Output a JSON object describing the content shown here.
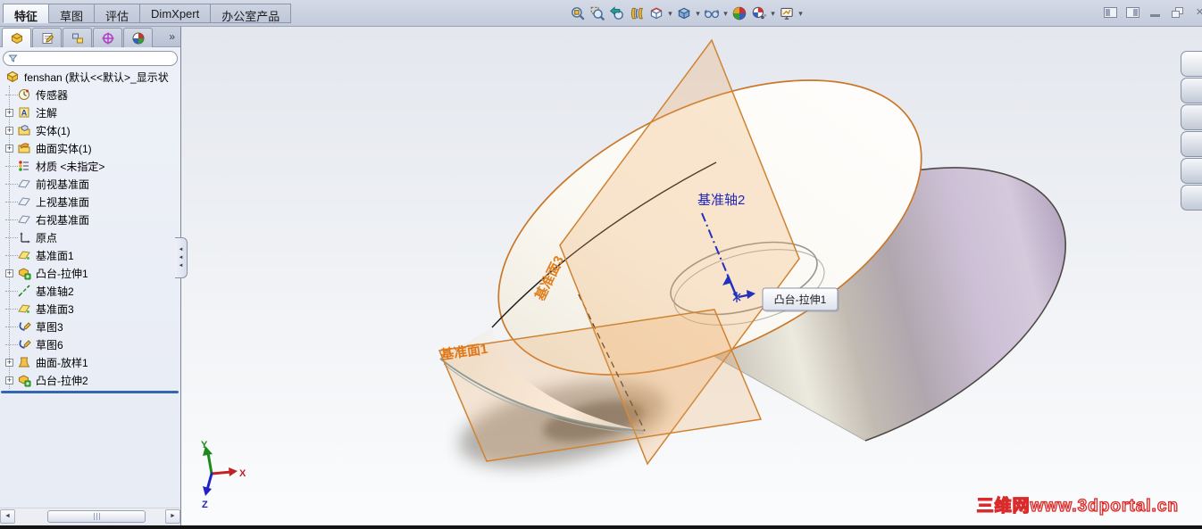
{
  "command_tabs": [
    {
      "label": "特征",
      "active": true
    },
    {
      "label": "草图",
      "active": false
    },
    {
      "label": "评估",
      "active": false
    },
    {
      "label": "DimXpert",
      "active": false
    },
    {
      "label": "办公室产品",
      "active": false
    }
  ],
  "headsup_toolbar": [
    {
      "name": "zoom-to-fit",
      "dropdown": false
    },
    {
      "name": "zoom-to-area",
      "dropdown": false
    },
    {
      "name": "previous-view",
      "dropdown": false
    },
    {
      "name": "section-view",
      "dropdown": false
    },
    {
      "name": "view-orientation",
      "dropdown": true
    },
    {
      "name": "display-style",
      "dropdown": true
    },
    {
      "name": "hide-show-items",
      "dropdown": true
    },
    {
      "name": "apply-scene",
      "dropdown": false
    },
    {
      "name": "edit-appearance",
      "dropdown": true
    },
    {
      "name": "view-settings",
      "dropdown": true
    }
  ],
  "window_buttons": [
    "toggle-left-pane",
    "toggle-right-pane",
    "minimize",
    "restore",
    "close"
  ],
  "left_panel": {
    "manager_tabs": [
      "featuremanager",
      "propertymanager",
      "configurationmanager",
      "dimxpertmanager",
      "displaymanager"
    ],
    "overflow_chevron": "»",
    "filter": {
      "value": "",
      "placeholder": ""
    },
    "tree": [
      {
        "label": "fenshan (默认<<默认>_显示状",
        "icon": "part",
        "root": true,
        "expand": false
      },
      {
        "label": "传感器",
        "icon": "sensor",
        "expand": false
      },
      {
        "label": "注解",
        "icon": "annotation",
        "expand": true
      },
      {
        "label": "实体(1)",
        "icon": "solid-bodies",
        "expand": true
      },
      {
        "label": "曲面实体(1)",
        "icon": "surface-bodies",
        "expand": true
      },
      {
        "label": "材质 <未指定>",
        "icon": "material",
        "expand": false
      },
      {
        "label": "前视基准面",
        "icon": "plane",
        "expand": false
      },
      {
        "label": "上视基准面",
        "icon": "plane",
        "expand": false
      },
      {
        "label": "右视基准面",
        "icon": "plane",
        "expand": false
      },
      {
        "label": "原点",
        "icon": "origin",
        "expand": false
      },
      {
        "label": "基准面1",
        "icon": "plane-gold",
        "expand": false
      },
      {
        "label": "凸台-拉伸1",
        "icon": "extrude",
        "expand": true
      },
      {
        "label": "基准轴2",
        "icon": "axis",
        "expand": false
      },
      {
        "label": "基准面3",
        "icon": "plane-gold",
        "expand": false
      },
      {
        "label": "草图3",
        "icon": "sketch",
        "expand": false
      },
      {
        "label": "草图6",
        "icon": "sketch",
        "expand": false
      },
      {
        "label": "曲面-放样1",
        "icon": "loft",
        "expand": true
      },
      {
        "label": "凸台-拉伸2",
        "icon": "extrude",
        "expand": true
      }
    ]
  },
  "viewport": {
    "plane1_label": "基准面1",
    "plane3_label": "基准面3",
    "axis_label": "基准轴2",
    "tooltip": "凸台-拉伸1",
    "triad": {
      "x": "X",
      "y": "Y",
      "z": "Z"
    },
    "watermark": "三维网www.3dportal.cn",
    "task_pane_tab_count": 6,
    "colors": {
      "plane_fill": "#f0a85a",
      "plane_edge": "#cf8332",
      "axis_blue": "#2230bb",
      "edge_orange": "#c9782a",
      "side_purple": "#c4b6ce",
      "watermark_red": "#d92b2b"
    }
  },
  "ui": {
    "glyphs": {
      "expander_plus": "+",
      "dropdown": "▾",
      "scroll_left": "◄",
      "scroll_right": "►",
      "splitter_arrow": "◄",
      "close": "✕"
    }
  }
}
